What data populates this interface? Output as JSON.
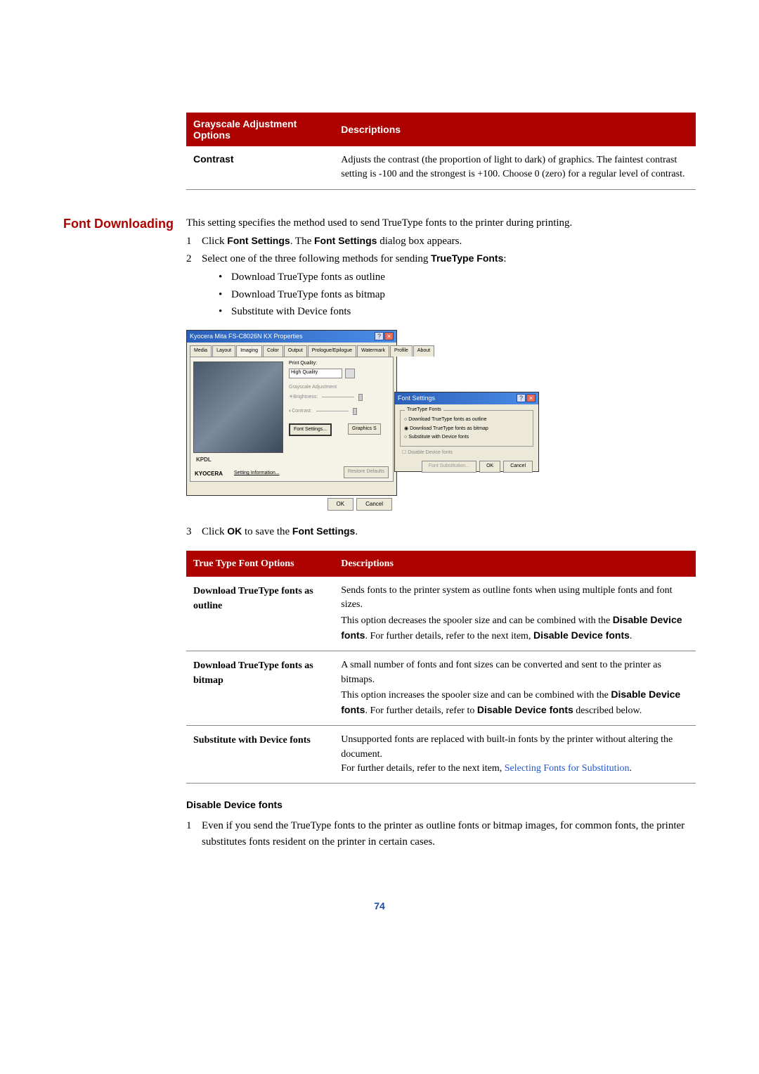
{
  "tables": {
    "grayscale": {
      "header_col1": "Grayscale Adjustment Options",
      "header_col2": "Descriptions",
      "row1_label": "Contrast",
      "row1_desc": "Adjusts the contrast (the proportion of light to dark) of graphics. The faintest contrast setting is -100 and the strongest is +100. Choose 0 (zero) for a regular level of contrast."
    },
    "truetype": {
      "header_col1": "True Type Font Options",
      "header_col2": "Descriptions",
      "rows": {
        "r1_label": "Download TrueType fonts as outline",
        "r1_desc_a": "Sends fonts to the printer system as outline fonts when using multiple fonts and font sizes.",
        "r1_desc_b": "This option decreases the spooler size and can be combined with the ",
        "r1_desc_c": "Disable Device fonts",
        "r1_desc_d": ". For further details, refer to the next item, ",
        "r1_desc_e": "Disable Device fonts",
        "r1_dot": ".",
        "r2_label": "Download TrueType fonts as bitmap",
        "r2_desc_a": "A small number of fonts and font sizes can be converted and sent to the printer as bitmaps.",
        "r2_desc_b": "This option increases the spooler size and can be combined with the ",
        "r2_desc_c": "Disable Device fonts",
        "r2_desc_d": ". For further details, refer to ",
        "r2_desc_e": "Disable Device fonts",
        "r2_desc_f": " described below.",
        "r3_label": "Substitute with Device fonts",
        "r3_desc_a": "Unsupported fonts are replaced with built-in fonts by the printer without altering the document.",
        "r3_desc_b": "For further details, refer to the next item, ",
        "r3_desc_c": "Selecting Fonts for Substitution",
        "r3_dot": "."
      }
    }
  },
  "section": {
    "title": "Font Downloading",
    "intro": "This setting specifies the method used to send TrueType fonts to the printer during printing.",
    "step1_a": "Click ",
    "step1_b": "Font Settings",
    "step1_c": ". The ",
    "step1_d": "Font Settings",
    "step1_e": " dialog box appears.",
    "step2_a": "Select one of the three following methods for sending ",
    "step2_b": "TrueType Fonts",
    "step2_c": ":",
    "bullets": {
      "b1": "Download TrueType fonts as outline",
      "b2": "Download TrueType fonts as bitmap",
      "b3": "Substitute with Device fonts"
    },
    "step3_a": "Click ",
    "step3_b": "OK",
    "step3_c": " to save the ",
    "step3_d": "Font Settings",
    "step3_dot": "."
  },
  "screenshot": {
    "win1_title": "Kyocera Mita FS-C8026N KX Properties",
    "tabs": {
      "t1": "Media",
      "t2": "Layout",
      "t3": "Imaging",
      "t4": "Color",
      "t5": "Output",
      "t6": "Prologue/Epilogue",
      "t7": "Watermark",
      "t8": "Profile",
      "t9": "About"
    },
    "print_quality": "Print Quality:",
    "high_quality": "High Quality",
    "grayscale_adj": "Grayscale Adjustment",
    "brightness": "Brightness:",
    "contrast": "Contrast:",
    "font_settings_btn": "Font Settings...",
    "graphics_btn": "Graphics S",
    "kpdl": "KPDL",
    "kyocera": "KYOCERA",
    "setting_info": "Setting Information...",
    "restore": "Restore Defaults",
    "ok": "OK",
    "cancel": "Cancel",
    "win2_title": "Font Settings",
    "truetype_fonts": "TrueType Fonts",
    "opt1": "Download TrueType fonts as outline",
    "opt2": "Download TrueType fonts as bitmap",
    "opt3": "Substitute with Device fonts",
    "disable_device": "Disable Device fonts",
    "font_subst": "Font Substitution..."
  },
  "disable_section": {
    "title": "Disable Device fonts",
    "step1": "Even if you send the TrueType fonts to the printer as outline fonts or bitmap images, for common fonts, the printer substitutes fonts resident on the printer in certain cases."
  },
  "page_number": "74",
  "num1": "1",
  "num2": "2",
  "num3": "3",
  "dot": "•"
}
